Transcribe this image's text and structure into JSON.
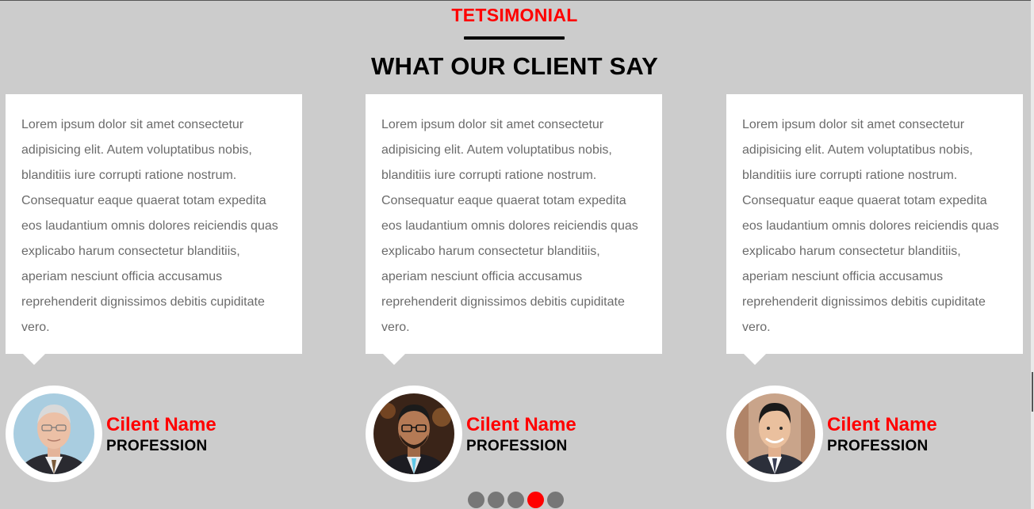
{
  "header": {
    "eyebrow": "TETSIMONIAL",
    "title": "WHAT OUR CLIENT SAY"
  },
  "testimonials": [
    {
      "quote": "Lorem ipsum dolor sit amet consectetur adipisicing elit. Autem voluptatibus nobis, blanditiis iure corrupti ratione nostrum. Consequatur eaque quaerat totam expedita eos laudantium omnis dolores reiciendis quas explicabo harum consectetur blanditiis, aperiam nesciunt officia accusamus reprehenderit dignissimos debitis cupiditate vero.",
      "name": "Cilent Name",
      "profession": "PROFESSION"
    },
    {
      "quote": "Lorem ipsum dolor sit amet consectetur adipisicing elit. Autem voluptatibus nobis, blanditiis iure corrupti ratione nostrum. Consequatur eaque quaerat totam expedita eos laudantium omnis dolores reiciendis quas explicabo harum consectetur blanditiis, aperiam nesciunt officia accusamus reprehenderit dignissimos debitis cupiditate vero.",
      "name": "Cilent Name",
      "profession": "PROFESSION"
    },
    {
      "quote": "Lorem ipsum dolor sit amet consectetur adipisicing elit. Autem voluptatibus nobis, blanditiis iure corrupti ratione nostrum. Consequatur eaque quaerat totam expedita eos laudantium omnis dolores reiciendis quas explicabo harum consectetur blanditiis, aperiam nesciunt officia accusamus reprehenderit dignissimos debitis cupiditate vero.",
      "name": "Cilent Name",
      "profession": "PROFESSION"
    }
  ],
  "carousel": {
    "slide_count": 5,
    "active_index": 3
  },
  "colors": {
    "accent": "#ff0000",
    "background": "#cccccc",
    "card": "#ffffff",
    "body_text": "#6b6b6b",
    "dot": "#777777"
  }
}
